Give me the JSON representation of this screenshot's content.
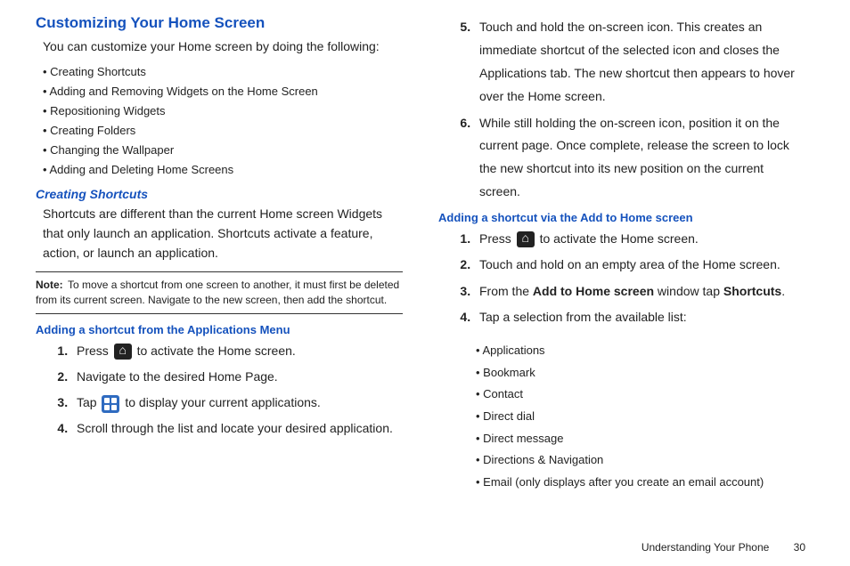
{
  "headings": {
    "main": "Customizing Your Home Screen",
    "creating_shortcuts": "Creating Shortcuts",
    "adding_from_apps": "Adding a shortcut from the Applications Menu",
    "adding_via_home": "Adding a shortcut via the Add to Home screen"
  },
  "intro_text": "You can customize your Home screen by doing the following:",
  "bullets_intro": [
    "Creating Shortcuts",
    "Adding and Removing Widgets on the Home Screen",
    "Repositioning Widgets",
    "Creating Folders",
    "Changing the Wallpaper",
    "Adding and Deleting Home Screens"
  ],
  "creating_shortcuts_para": "Shortcuts are different than the current Home screen Widgets that only launch an application. Shortcuts activate a feature, action, or launch an application.",
  "note": {
    "label": "Note:",
    "body": "To move a shortcut from one screen to another, it must first be deleted from its current screen. Navigate to the new screen, then add the shortcut."
  },
  "steps_from_apps": {
    "s1_pre": "Press ",
    "s1_post": " to activate the Home screen.",
    "s2": "Navigate to the desired Home Page.",
    "s3_pre": "Tap ",
    "s3_post": " to display your current applications.",
    "s4": "Scroll through the list and locate your desired application.",
    "s5": "Touch and hold the on-screen icon. This creates an immediate shortcut of the selected icon and closes the Applications tab. The new shortcut then appears to hover over the Home screen.",
    "s6": "While still holding the on-screen icon, position it on the current page. Once complete, release the screen to lock the new shortcut into its new position on the current screen."
  },
  "steps_via_home": {
    "s1_pre": "Press ",
    "s1_post": " to activate the Home screen.",
    "s2": "Touch and hold on an empty area of the Home screen.",
    "s3_pre": "From the ",
    "s3_bold1": "Add to Home screen",
    "s3_mid": " window tap ",
    "s3_bold2": "Shortcuts",
    "s3_post": ".",
    "s4": "Tap a selection from the available list:"
  },
  "available_list": [
    "Applications",
    "Bookmark",
    "Contact",
    "Direct dial",
    "Direct message",
    "Directions & Navigation",
    "Email (only displays after you create an email account)"
  ],
  "footer": {
    "section": "Understanding Your Phone",
    "page": "30"
  }
}
